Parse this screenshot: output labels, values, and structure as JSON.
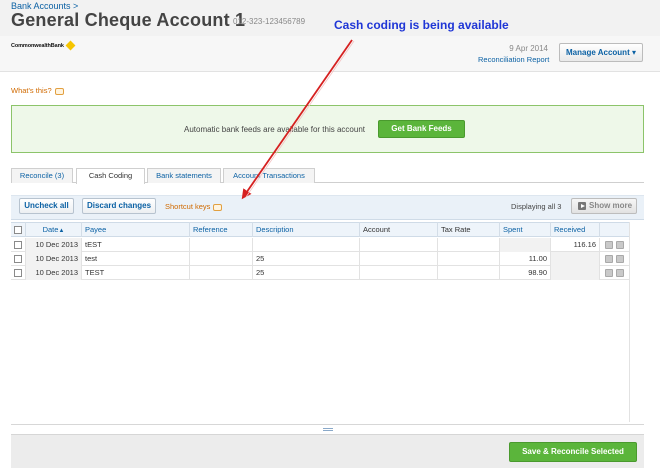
{
  "header": {
    "breadcrumb": "Bank Accounts >",
    "title": "General Cheque Account 1",
    "account_number": "012-323-123456789",
    "bank_logo_text": "CommonwealthBank",
    "reconciled_date": "9 Apr 2014",
    "reconciliation_report": "Reconciliation Report",
    "manage_account": "Manage Account ▾"
  },
  "annotation": "Cash coding is being available",
  "whats_this": "What's this?",
  "feeds": {
    "message": "Automatic bank feeds are available for this account",
    "button": "Get Bank Feeds"
  },
  "tabs": [
    {
      "label": "Reconcile (3)",
      "active": false
    },
    {
      "label": "Cash Coding",
      "active": true
    },
    {
      "label": "Bank statements",
      "active": false
    },
    {
      "label": "Account Transactions",
      "active": false
    }
  ],
  "toolbar": {
    "uncheck_all": "Uncheck all",
    "discard_changes": "Discard changes",
    "shortcut_keys": "Shortcut keys",
    "displaying": "Displaying all 3",
    "show_more": "Show more"
  },
  "table": {
    "columns": [
      "Date",
      "Payee",
      "Reference",
      "Description",
      "Account",
      "Tax Rate",
      "Spent",
      "Received"
    ],
    "sort_indicator": "▲",
    "rows": [
      {
        "date": "10 Dec 2013",
        "payee": "tEST",
        "reference": "",
        "description": "",
        "account": "",
        "tax_rate": "",
        "spent": "",
        "received": "116.16"
      },
      {
        "date": "10 Dec 2013",
        "payee": "test",
        "reference": "",
        "description": "25",
        "account": "",
        "tax_rate": "",
        "spent": "11.00",
        "received": ""
      },
      {
        "date": "10 Dec 2013",
        "payee": "TEST",
        "reference": "",
        "description": "25",
        "account": "",
        "tax_rate": "",
        "spent": "98.90",
        "received": ""
      }
    ]
  },
  "footer": {
    "save_reconcile": "Save & Reconcile Selected"
  },
  "colors": {
    "accent_green": "#5bb53b",
    "link_blue": "#0b61a4",
    "annotation_blue": "#1f36d6",
    "arrow_red": "#d62020"
  }
}
